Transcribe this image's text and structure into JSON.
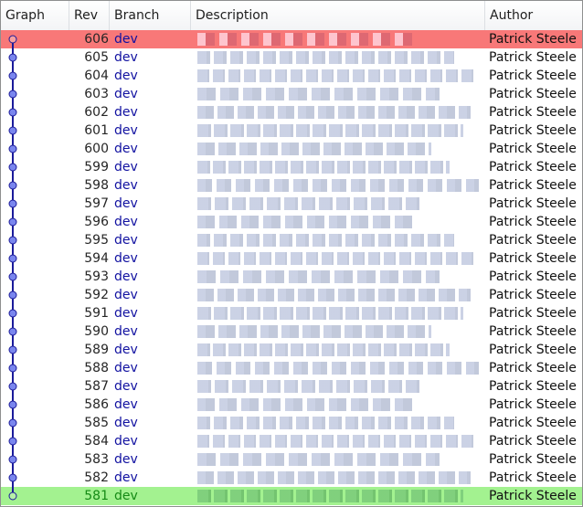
{
  "header": {
    "graph": "Graph",
    "rev": "Rev",
    "branch": "Branch",
    "description": "Description",
    "author": "Author"
  },
  "colors": {
    "highlight_top": "#f87878",
    "highlight_bottom": "#a3f290",
    "graph_line": "#1b1b9a",
    "node_fill": "#7a86ee",
    "branch_text": "#1010a0"
  },
  "rows": [
    {
      "rev": "606",
      "branch": "dev",
      "author": "Patrick Steele",
      "highlight": "red"
    },
    {
      "rev": "605",
      "branch": "dev",
      "author": "Patrick Steele",
      "highlight": ""
    },
    {
      "rev": "604",
      "branch": "dev",
      "author": "Patrick Steele",
      "highlight": ""
    },
    {
      "rev": "603",
      "branch": "dev",
      "author": "Patrick Steele",
      "highlight": ""
    },
    {
      "rev": "602",
      "branch": "dev",
      "author": "Patrick Steele",
      "highlight": ""
    },
    {
      "rev": "601",
      "branch": "dev",
      "author": "Patrick Steele",
      "highlight": ""
    },
    {
      "rev": "600",
      "branch": "dev",
      "author": "Patrick Steele",
      "highlight": ""
    },
    {
      "rev": "599",
      "branch": "dev",
      "author": "Patrick Steele",
      "highlight": ""
    },
    {
      "rev": "598",
      "branch": "dev",
      "author": "Patrick Steele",
      "highlight": ""
    },
    {
      "rev": "597",
      "branch": "dev",
      "author": "Patrick Steele",
      "highlight": ""
    },
    {
      "rev": "596",
      "branch": "dev",
      "author": "Patrick Steele",
      "highlight": ""
    },
    {
      "rev": "595",
      "branch": "dev",
      "author": "Patrick Steele",
      "highlight": ""
    },
    {
      "rev": "594",
      "branch": "dev",
      "author": "Patrick Steele",
      "highlight": ""
    },
    {
      "rev": "593",
      "branch": "dev",
      "author": "Patrick Steele",
      "highlight": ""
    },
    {
      "rev": "592",
      "branch": "dev",
      "author": "Patrick Steele",
      "highlight": ""
    },
    {
      "rev": "591",
      "branch": "dev",
      "author": "Patrick Steele",
      "highlight": ""
    },
    {
      "rev": "590",
      "branch": "dev",
      "author": "Patrick Steele",
      "highlight": ""
    },
    {
      "rev": "589",
      "branch": "dev",
      "author": "Patrick Steele",
      "highlight": ""
    },
    {
      "rev": "588",
      "branch": "dev",
      "author": "Patrick Steele",
      "highlight": ""
    },
    {
      "rev": "587",
      "branch": "dev",
      "author": "Patrick Steele",
      "highlight": ""
    },
    {
      "rev": "586",
      "branch": "dev",
      "author": "Patrick Steele",
      "highlight": ""
    },
    {
      "rev": "585",
      "branch": "dev",
      "author": "Patrick Steele",
      "highlight": ""
    },
    {
      "rev": "584",
      "branch": "dev",
      "author": "Patrick Steele",
      "highlight": ""
    },
    {
      "rev": "583",
      "branch": "dev",
      "author": "Patrick Steele",
      "highlight": ""
    },
    {
      "rev": "582",
      "branch": "dev",
      "author": "Patrick Steele",
      "highlight": ""
    },
    {
      "rev": "581",
      "branch": "dev",
      "author": "Patrick Steele",
      "highlight": "green"
    }
  ]
}
